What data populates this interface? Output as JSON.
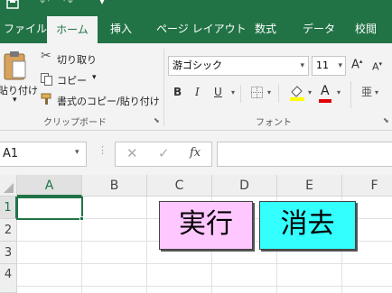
{
  "ribbon_tabs": [
    "ファイル",
    "ホーム",
    "挿入",
    "ページ レイアウト",
    "数式",
    "データ",
    "校閲"
  ],
  "active_tab": "ホーム",
  "clipboard": {
    "paste_label": "貼り付け",
    "cut_label": "切り取り",
    "copy_label": "コピー",
    "format_painter_label": "書式のコピー/貼り付け",
    "group_label": "クリップボード"
  },
  "font": {
    "name": "游ゴシック",
    "size": "11",
    "group_label": "フォント",
    "bold": "B",
    "italic": "I",
    "underline": "U",
    "grow": "A",
    "shrink": "A",
    "font_color_letter": "A"
  },
  "formula_bar": {
    "name_box": "A1",
    "fx": "fx",
    "value": ""
  },
  "columns": [
    "A",
    "B",
    "C",
    "D",
    "E",
    "F"
  ],
  "rows": [
    "1",
    "2",
    "3",
    "4"
  ],
  "selected_cell": "A1",
  "buttons": {
    "run": "実行",
    "clear": "消去"
  },
  "colors": {
    "excel_green": "#217346",
    "run_button_bg": "#ffc7ff",
    "clear_button_bg": "#33ffff"
  }
}
